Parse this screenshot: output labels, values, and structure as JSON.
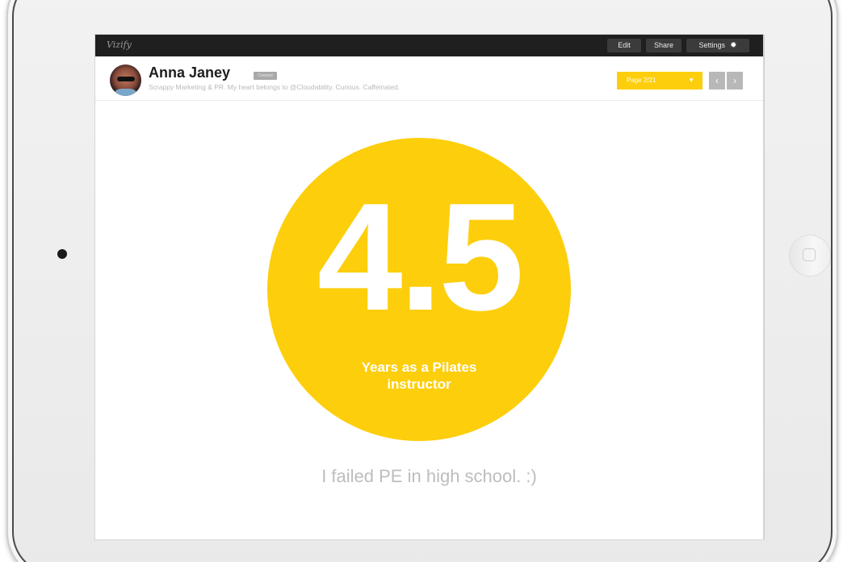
{
  "app": {
    "brand": "Vizify"
  },
  "toolbar": {
    "edit_label": "Edit",
    "share_label": "Share",
    "settings_label": "Settings",
    "settings_icon": "gear-icon"
  },
  "profile": {
    "name": "Anna Janey",
    "badge": "Connect",
    "bio": "Scrappy Marketing & PR. My heart belongs to @Cloudability. Curious. Caffeinated."
  },
  "pagination": {
    "current_label": "Page 2/21",
    "dropdown_icon": "▼",
    "prev_icon": "‹",
    "next_icon": "›"
  },
  "stat": {
    "value": "4.5",
    "caption_line1": "Years as a Pilates",
    "caption_line2": "instructor"
  },
  "footnote": "I failed PE in high school. :)",
  "colors": {
    "accent": "#fdce0b",
    "topbar": "#1f1f1f",
    "muted_text": "#bdbdbd"
  }
}
